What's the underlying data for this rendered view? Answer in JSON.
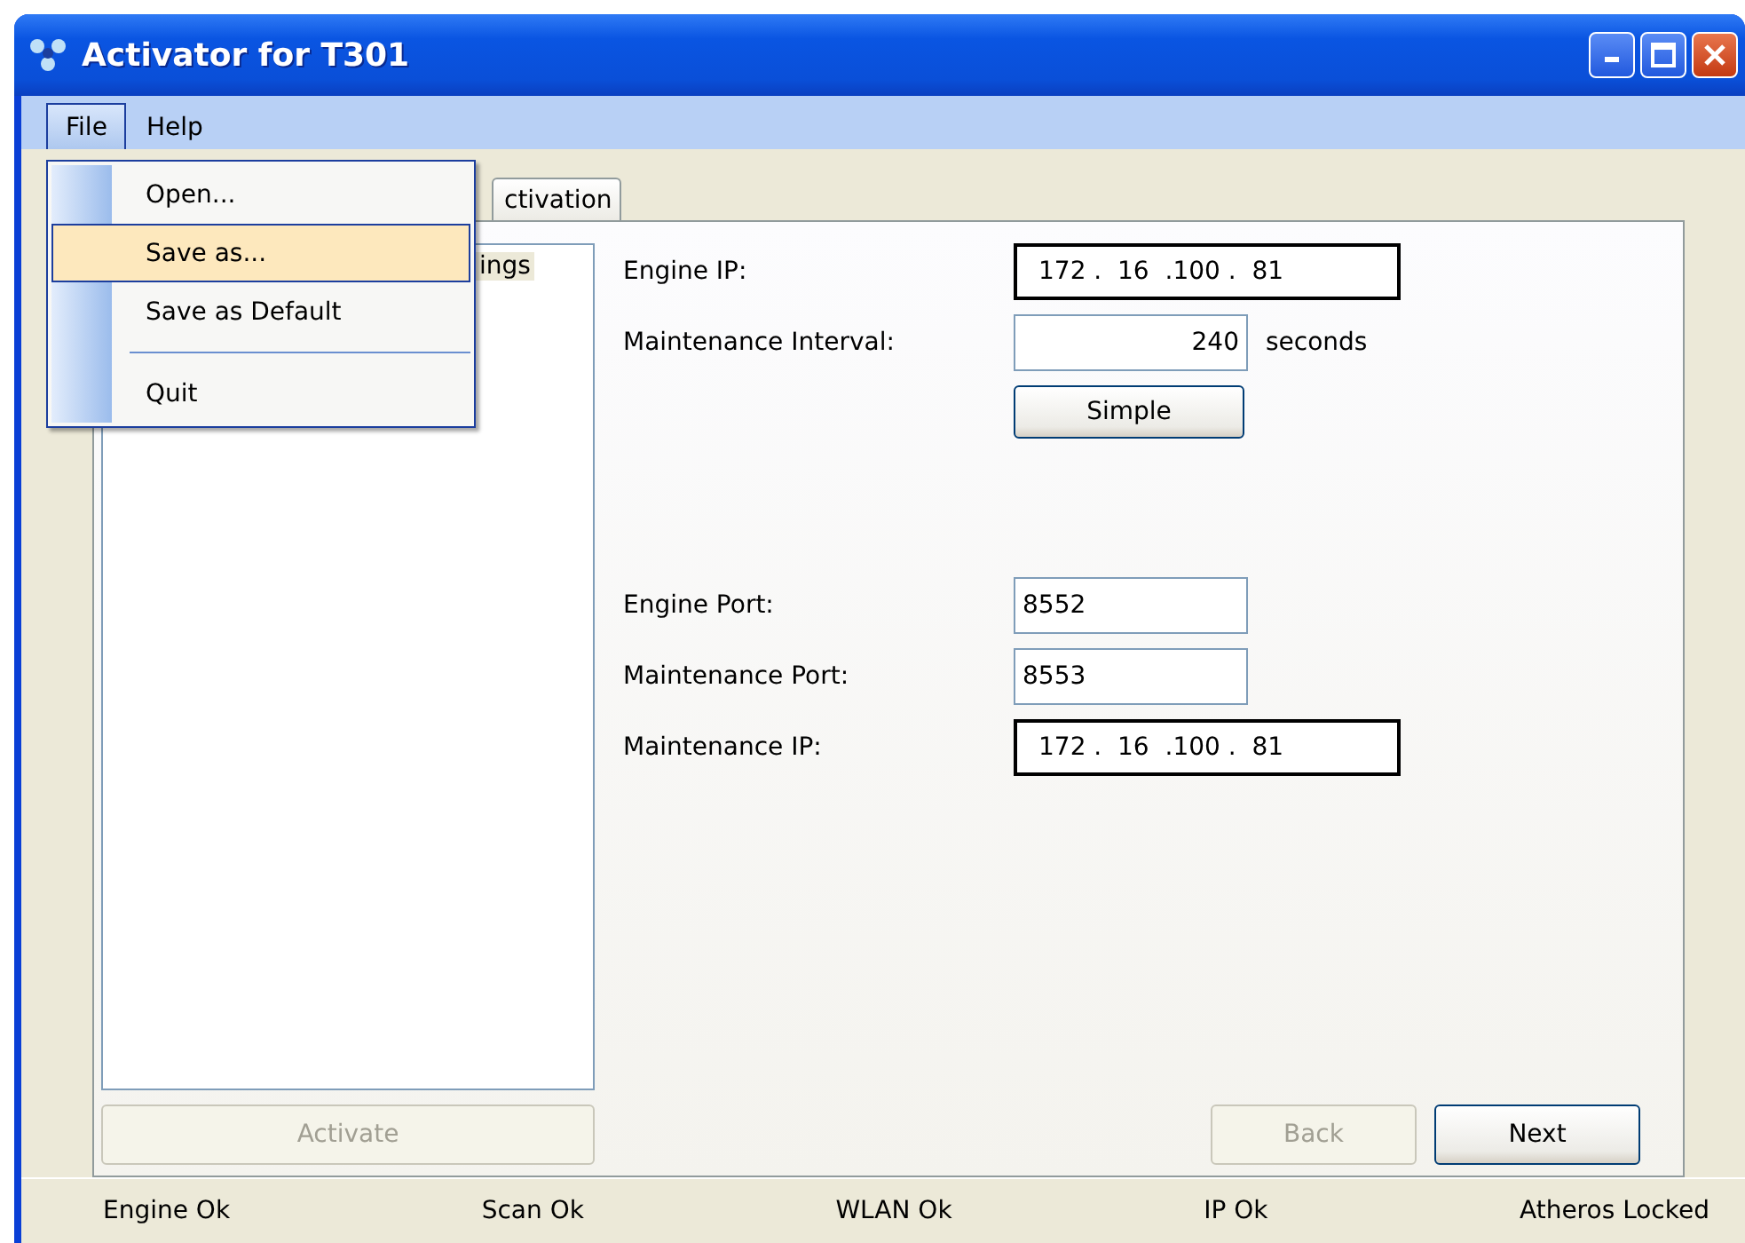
{
  "window": {
    "title": "Activator for T301"
  },
  "menu_bar": [
    {
      "label": "File",
      "selected": true
    },
    {
      "label": "Help",
      "selected": false
    }
  ],
  "file_menu": [
    {
      "kind": "item",
      "label": "Open...",
      "selected": false
    },
    {
      "kind": "item",
      "label": "Save as...",
      "selected": true
    },
    {
      "kind": "item",
      "label": "Save as Default",
      "selected": false
    },
    {
      "kind": "separator"
    },
    {
      "kind": "item",
      "label": "Quit",
      "selected": false
    }
  ],
  "tabs": [
    {
      "label": "ctivation",
      "selected": false
    }
  ],
  "list": {
    "items": [
      {
        "label": "ings",
        "selected": true
      }
    ]
  },
  "form": {
    "rows": [
      {
        "kind": "ip",
        "label": "Engine IP:",
        "value": "172 .  16  .100 .  81"
      },
      {
        "kind": "number",
        "label": "Maintenance Interval:",
        "value": "240",
        "unit": "seconds"
      },
      {
        "kind": "button",
        "label": "Simple"
      },
      {
        "kind": "spacer"
      },
      {
        "kind": "text",
        "label": "Engine Port:",
        "value": "8552"
      },
      {
        "kind": "text",
        "label": "Maintenance Port:",
        "value": "8553"
      },
      {
        "kind": "ip",
        "label": "Maintenance IP:",
        "value": "172 .  16  .100 .  81"
      }
    ]
  },
  "buttons": {
    "activate": {
      "label": "Activate",
      "disabled": true
    },
    "back": {
      "label": "Back",
      "disabled": true
    },
    "next": {
      "label": "Next",
      "disabled": false
    }
  },
  "status_bar": [
    "Engine Ok",
    "Scan Ok",
    "WLAN Ok",
    "IP Ok",
    "Atheros Locked"
  ]
}
